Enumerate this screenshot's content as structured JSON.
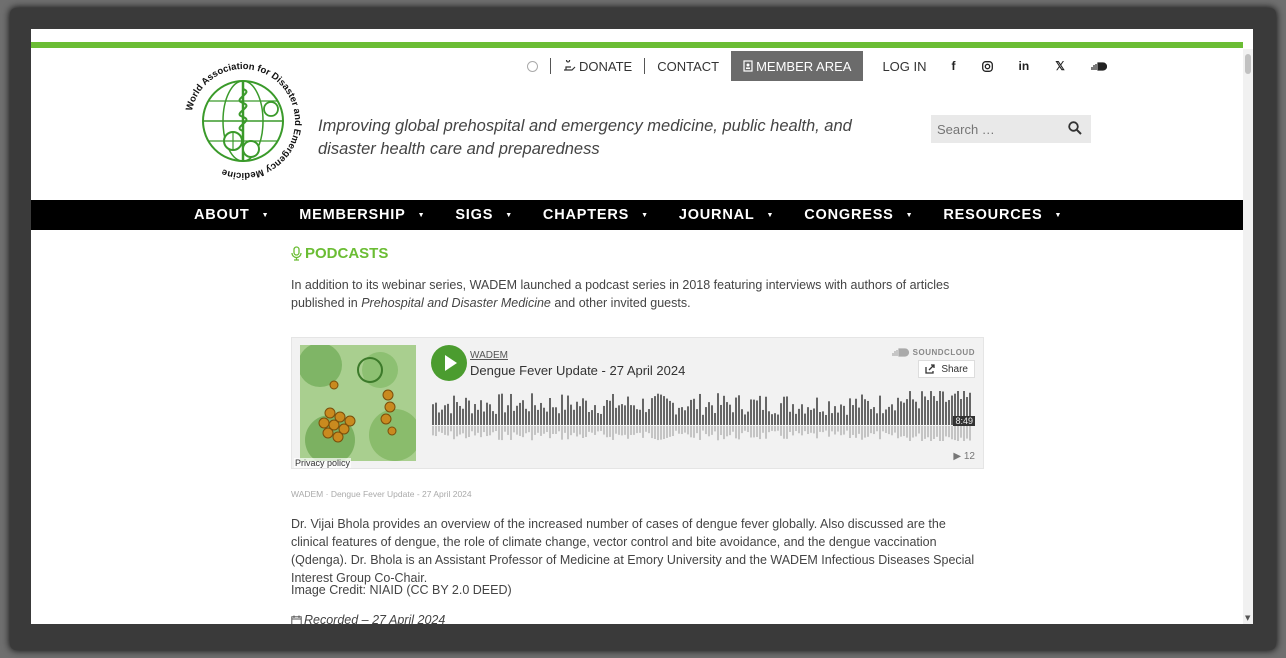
{
  "topbar": {
    "donate": "DONATE",
    "contact": "CONTACT",
    "member_area": "MEMBER AREA",
    "login": "LOG IN",
    "social_icons": [
      "facebook-icon",
      "instagram-icon",
      "linkedin-icon",
      "x-icon",
      "soundcloud-icon"
    ]
  },
  "logo": {
    "text": "World Association for Disaster and Emergency Medicine"
  },
  "tagline": "Improving global prehospital and emergency medicine, public health, and disaster health care and preparedness",
  "search": {
    "placeholder": "Search …"
  },
  "mainnav": {
    "items": [
      "ABOUT",
      "MEMBERSHIP",
      "SIGS",
      "CHAPTERS",
      "JOURNAL",
      "CONGRESS",
      "RESOURCES"
    ]
  },
  "page": {
    "heading": "PODCASTS",
    "intro_1": "In addition to its webinar series, WADEM launched a podcast series in 2018 featuring interviews with authors of articles published in",
    "intro_journal": "Prehospital and Disaster Medicine",
    "intro_2": "and other invited guests."
  },
  "player": {
    "user": "WADEM",
    "track": "Dengue Fever Update - 27 April 2024",
    "brand": "SOUNDCLOUD",
    "share": "Share",
    "duration": "8:49",
    "plays": "12",
    "privacy": "Privacy policy"
  },
  "episode": {
    "caption": "WADEM · Dengue Fever Update - 27 April 2024",
    "description": "Dr. Vijai Bhola provides an overview of the increased number of cases of dengue fever globally. Also discussed are the clinical features of dengue, the role of climate change, vector control and bite avoidance, and the dengue vaccination (Qdenga). Dr. Bhola is an Assistant Professor of Medicine at Emory University and the WADEM Infectious Diseases Special Interest Group Co-Chair.",
    "credit": "Image Credit: NIAID (CC BY 2.0 DEED)",
    "recorded": "Recorded – 27 April 2024"
  },
  "colors": {
    "brand_green": "#6bbd34",
    "nav_black": "#000000",
    "member_bg": "#6b6b6b"
  }
}
